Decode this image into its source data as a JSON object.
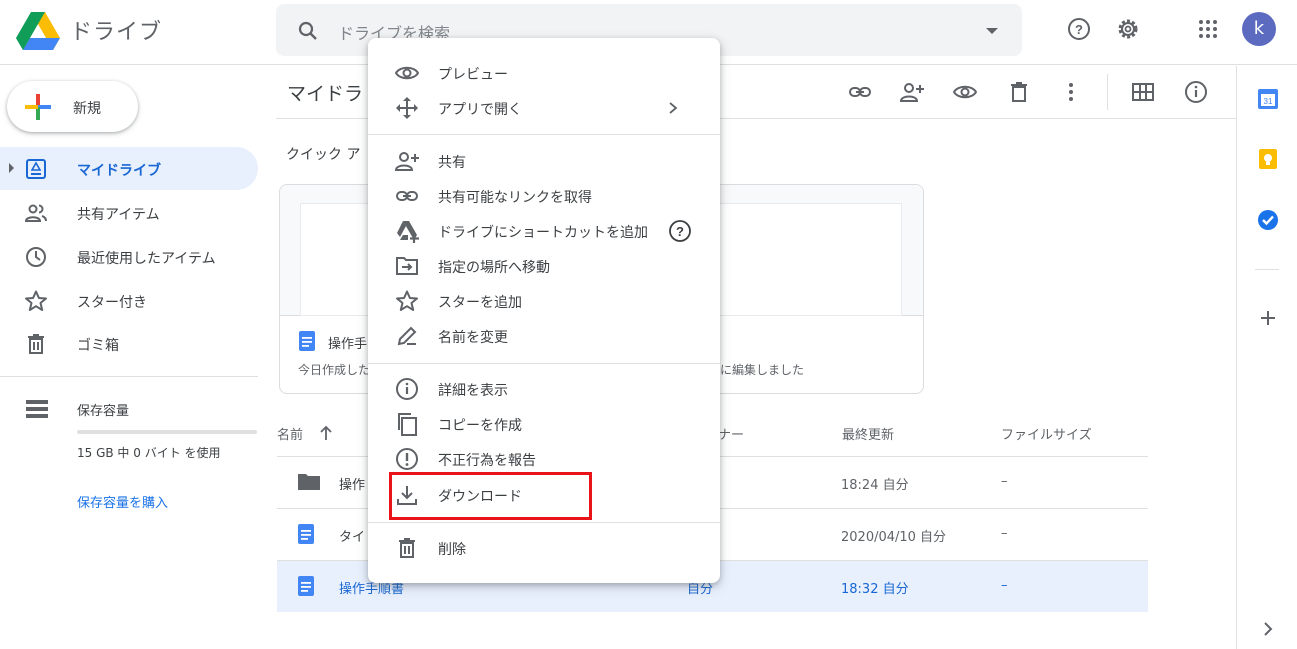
{
  "app": {
    "name": "ドライブ"
  },
  "search": {
    "placeholder": "ドライブを検索"
  },
  "header": {
    "avatar_letter": "k"
  },
  "sidebar": {
    "new_label": "新規",
    "items": [
      {
        "label": "マイドライブ",
        "icon": "my-drive-icon",
        "active": true
      },
      {
        "label": "共有アイテム",
        "icon": "shared-icon"
      },
      {
        "label": "最近使用したアイテム",
        "icon": "clock-icon"
      },
      {
        "label": "スター付き",
        "icon": "star-icon"
      },
      {
        "label": "ゴミ箱",
        "icon": "trash-icon"
      }
    ],
    "storage": {
      "label": "保存容量",
      "usage": "15 GB 中 0 バイト を使用",
      "buy": "保存容量を購入",
      "used_fraction": 0
    }
  },
  "main": {
    "title": "マイドラ",
    "quick_access": "クイック ア",
    "card": {
      "name": "操作手",
      "sub": "今日作成した",
      "sub2": "に編集しました"
    },
    "columns": {
      "name": "名前",
      "owner": "ナー",
      "modified": "最終更新",
      "size": "ファイルサイズ"
    },
    "rows": [
      {
        "name": "操作",
        "type": "folder",
        "owner": "",
        "modified": "18:24 自分",
        "size": "–"
      },
      {
        "name": "タイ",
        "type": "doc",
        "owner": "",
        "modified": "2020/04/10 自分",
        "size": "–"
      },
      {
        "name": "操作手順書",
        "type": "doc",
        "owner": "自分",
        "modified": "18:32 自分",
        "size": "–",
        "selected": true
      }
    ]
  },
  "context_menu": {
    "groups": [
      [
        {
          "label": "プレビュー",
          "icon": "eye-icon"
        },
        {
          "label": "アプリで開く",
          "icon": "move-arrows-icon",
          "submenu": true
        }
      ],
      [
        {
          "label": "共有",
          "icon": "person-add-icon"
        },
        {
          "label": "共有可能なリンクを取得",
          "icon": "link-icon"
        },
        {
          "label": "ドライブにショートカットを追加",
          "icon": "drive-shortcut-icon",
          "help": true
        },
        {
          "label": "指定の場所へ移動",
          "icon": "folder-move-icon"
        },
        {
          "label": "スターを追加",
          "icon": "star-icon"
        },
        {
          "label": "名前を変更",
          "icon": "pencil-icon"
        }
      ],
      [
        {
          "label": "詳細を表示",
          "icon": "info-icon"
        },
        {
          "label": "コピーを作成",
          "icon": "copy-icon"
        },
        {
          "label": "不正行為を報告",
          "icon": "report-icon"
        },
        {
          "label": "ダウンロード",
          "icon": "download-icon",
          "highlighted": true
        }
      ],
      [
        {
          "label": "削除",
          "icon": "trash-icon"
        }
      ]
    ]
  },
  "colors": {
    "accent": "#1a73e8",
    "active_bg": "#e8f0fe",
    "highlight_border": "#e8141a"
  }
}
